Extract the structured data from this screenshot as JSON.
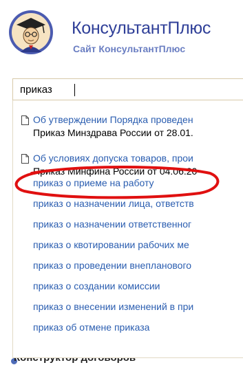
{
  "brand": {
    "title": "КонсультантПлюс",
    "subtitle": "Сайт КонсультантПлюс"
  },
  "search": {
    "value": "приказ"
  },
  "documents": [
    {
      "title": "Об утверждении Порядка проведен",
      "subtitle": "Приказ Минздрава России от 28.01."
    },
    {
      "title": "Об условиях допуска товаров, прои",
      "subtitle": "Приказ Минфина России от 04.06.20"
    }
  ],
  "suggestions": [
    "приказ о приеме на работу",
    "приказ о назначении лица, ответств",
    "приказ о назначении ответственног",
    "приказ о квотировании рабочих ме",
    "приказ о проведении внепланового",
    "приказ о создании комиссии",
    "приказ о внесении изменений в при",
    "приказ об отмене приказа"
  ],
  "footer": {
    "label": "Конструктор договоров"
  },
  "colors": {
    "brand": "#2f3f98",
    "link": "#2a5db0",
    "annotation": "#e01010"
  }
}
